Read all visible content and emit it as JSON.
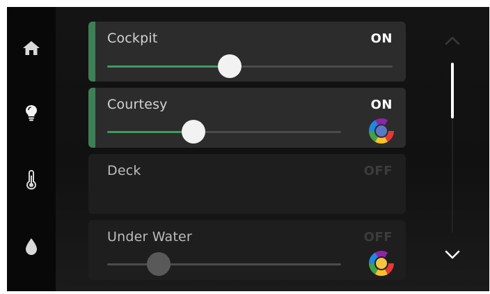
{
  "nav": {
    "items": [
      {
        "icon": "home-icon",
        "active": false
      },
      {
        "icon": "lightbulb-icon",
        "active": true
      },
      {
        "icon": "thermometer-icon",
        "active": false
      },
      {
        "icon": "water-drop-icon",
        "active": false
      }
    ]
  },
  "lights": [
    {
      "name": "Cockpit",
      "state": "ON",
      "level": 0.43,
      "has_color": false
    },
    {
      "name": "Courtesy",
      "state": "ON",
      "level": 0.37,
      "has_color": true
    },
    {
      "name": "Deck",
      "state": "OFF",
      "has_slider": false,
      "has_color": false
    },
    {
      "name": "Under Water",
      "state": "OFF",
      "level": 0.22,
      "has_color": true
    }
  ],
  "scroll": {
    "up_icon": "chevron-up-icon",
    "down_icon": "chevron-down-icon",
    "position": 0.0
  },
  "colors": {
    "accent": "#3f7f56",
    "fill": "#3f9a5e",
    "on_text": "#ffffff",
    "off_text": "#3c3c3c"
  }
}
